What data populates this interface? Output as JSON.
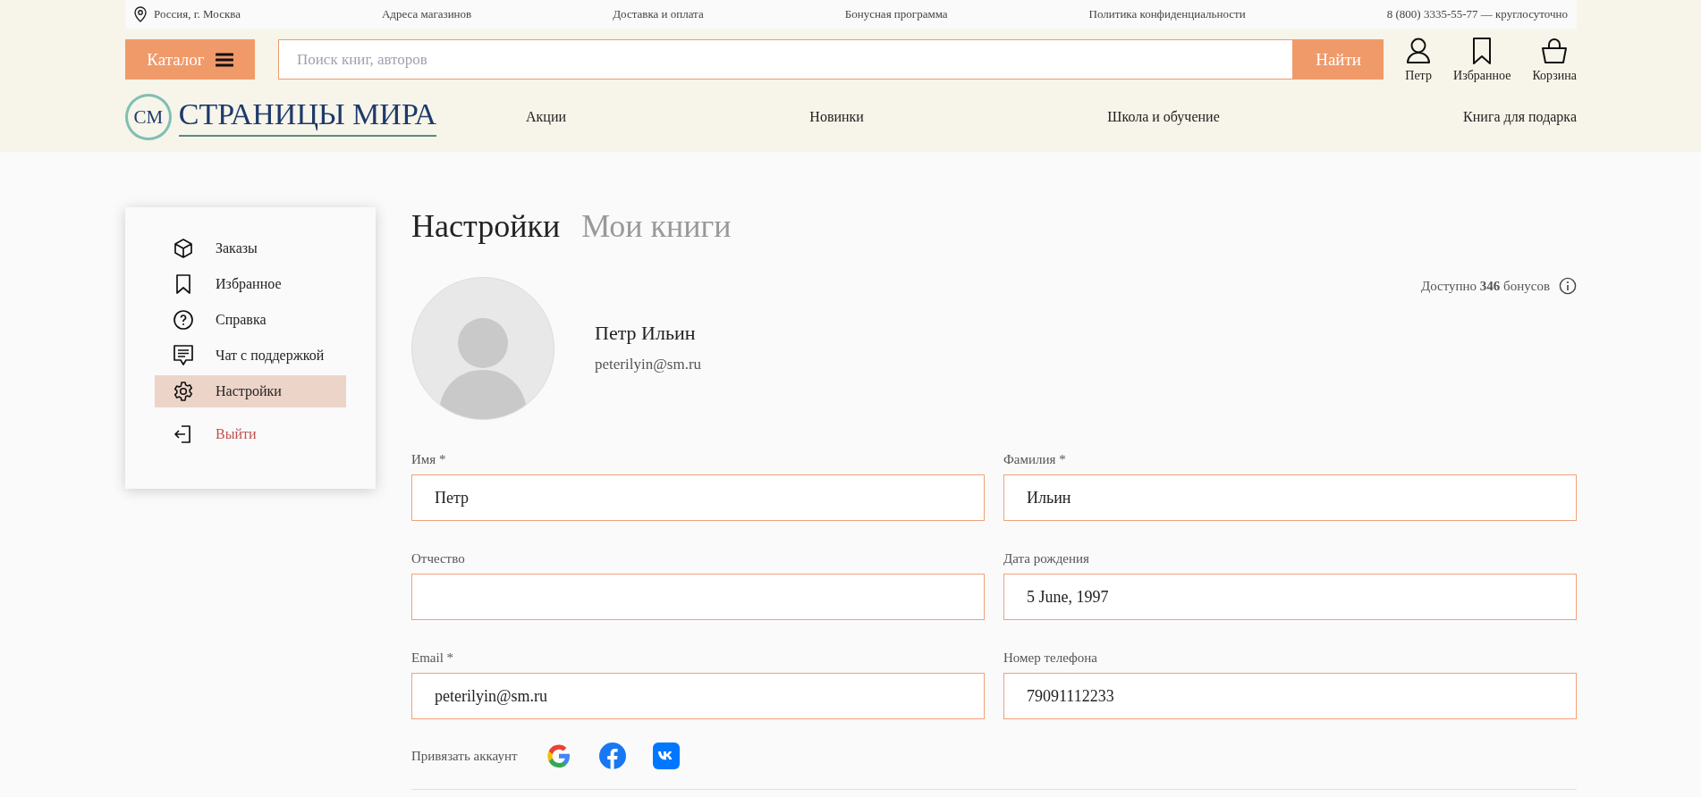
{
  "top_bar": {
    "location": "Россия, г. Москва",
    "links": [
      "Адреса магазинов",
      "Доставка и оплата",
      "Бонусная программа",
      "Политика конфиденциальности"
    ],
    "phone": "8 (800) 3335-55-77 — круглосуточно"
  },
  "header": {
    "catalog_button": "Каталог",
    "search": {
      "placeholder": "Поиск книг, авторов"
    },
    "search_button": "Найти",
    "actions": [
      {
        "kind": "user",
        "label": "Петр"
      },
      {
        "kind": "bookmark",
        "label": "Избранное"
      },
      {
        "kind": "basket",
        "label": "Корзина"
      }
    ],
    "logo": {
      "mark": "СМ",
      "name": "СТРАНИЦЫ МИРА"
    },
    "nav": [
      "Акции",
      "Новинки",
      "Школа и обучение",
      "Книга для подарка"
    ]
  },
  "sidebar": {
    "items": [
      {
        "kind": "box",
        "label": "Заказы",
        "selected": false
      },
      {
        "kind": "bookmark",
        "label": "Избранное",
        "selected": false
      },
      {
        "kind": "help",
        "label": "Справка",
        "selected": false
      },
      {
        "kind": "chat",
        "label": "Чат с поддержкой",
        "selected": false
      },
      {
        "kind": "gear",
        "label": "Настройки",
        "selected": true
      }
    ],
    "logout": "Выйти"
  },
  "tabs": [
    {
      "label": "Настройки",
      "selected": true
    },
    {
      "label": "Мои книги",
      "selected": false
    }
  ],
  "bonus": "Доступно **346** бонусов",
  "profile": {
    "name": "Петр Ильин",
    "email": "peterilyin@sm.ru"
  },
  "fields": [
    {
      "label": "Имя *",
      "value": "Петр"
    },
    {
      "label": "Фамилия *",
      "value": "Ильин"
    },
    {
      "label": "Отчество"
    },
    {
      "label": "Дата рождения",
      "value": "5 June, 1997"
    },
    {
      "label": "Email *",
      "value": "peterilyin@sm.ru"
    },
    {
      "label": "Номер телефона",
      "value": "79091112233"
    }
  ],
  "link_accounts": {
    "label": "Привязать аккаунт",
    "services": [
      {
        "kind": "google"
      },
      {
        "kind": "facebook"
      },
      {
        "kind": "vk"
      }
    ]
  }
}
